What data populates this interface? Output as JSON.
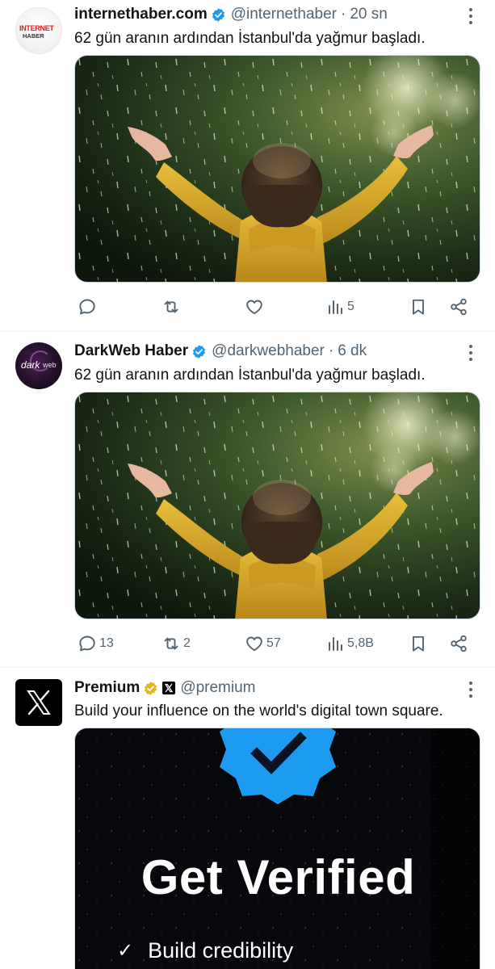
{
  "tweets": [
    {
      "name": "internethaber.com",
      "handle": "@internethaber",
      "dot": "·",
      "time": "20 sn",
      "text": "62 gün aranın ardından İstanbul'da yağmur başladı.",
      "avatar_label_top": "INTERNET",
      "avatar_label_bottom": "HABER",
      "verified_color": "#1d9bf0",
      "stats": {
        "replies": "",
        "retweets": "",
        "likes": "",
        "views": "5"
      }
    },
    {
      "name": "DarkWeb Haber",
      "handle": "@darkwebhaber",
      "dot": "·",
      "time": "6 dk",
      "text": "62 gün aranın ardından İstanbul'da yağmur başladı.",
      "avatar_label_top": "dark",
      "avatar_label_bottom": "web",
      "verified_color": "#1d9bf0",
      "stats": {
        "replies": "13",
        "retweets": "2",
        "likes": "57",
        "views": "5,8B"
      }
    },
    {
      "name": "Premium",
      "handle": "@premium",
      "text": "Build your influence on the world's digital town square.",
      "verified_color": "#e2b719",
      "media_title": "Get Verified",
      "media_bullet": "Build credibility"
    }
  ],
  "icons": [
    "reply-icon",
    "retweet-icon",
    "like-icon",
    "views-icon",
    "bookmark-icon",
    "share-icon",
    "more-icon",
    "verified-badge-icon",
    "x-logo-icon"
  ],
  "colors": {
    "text_secondary": "#536471",
    "verified_blue": "#1d9bf0",
    "verified_gold": "#e2b719",
    "raincoat": "#d9a521"
  }
}
